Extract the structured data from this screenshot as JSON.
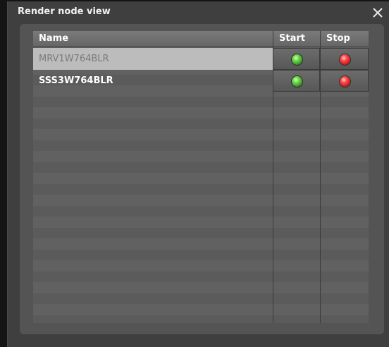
{
  "window": {
    "title": "Render node view",
    "close_icon": "close-icon"
  },
  "table": {
    "columns": [
      "Name",
      "Start",
      "Stop"
    ],
    "rows": [
      {
        "name": "MRV1W764BLR",
        "selected": true,
        "start_icon": "green-led-icon",
        "stop_icon": "red-led-icon"
      },
      {
        "name": "SSS3W764BLR",
        "selected": false,
        "start_icon": "green-led-icon",
        "stop_icon": "red-led-icon"
      }
    ]
  },
  "colors": {
    "start_led": "#4fbf2c",
    "stop_led": "#e02020",
    "selected_row": "#bcbcbc"
  }
}
